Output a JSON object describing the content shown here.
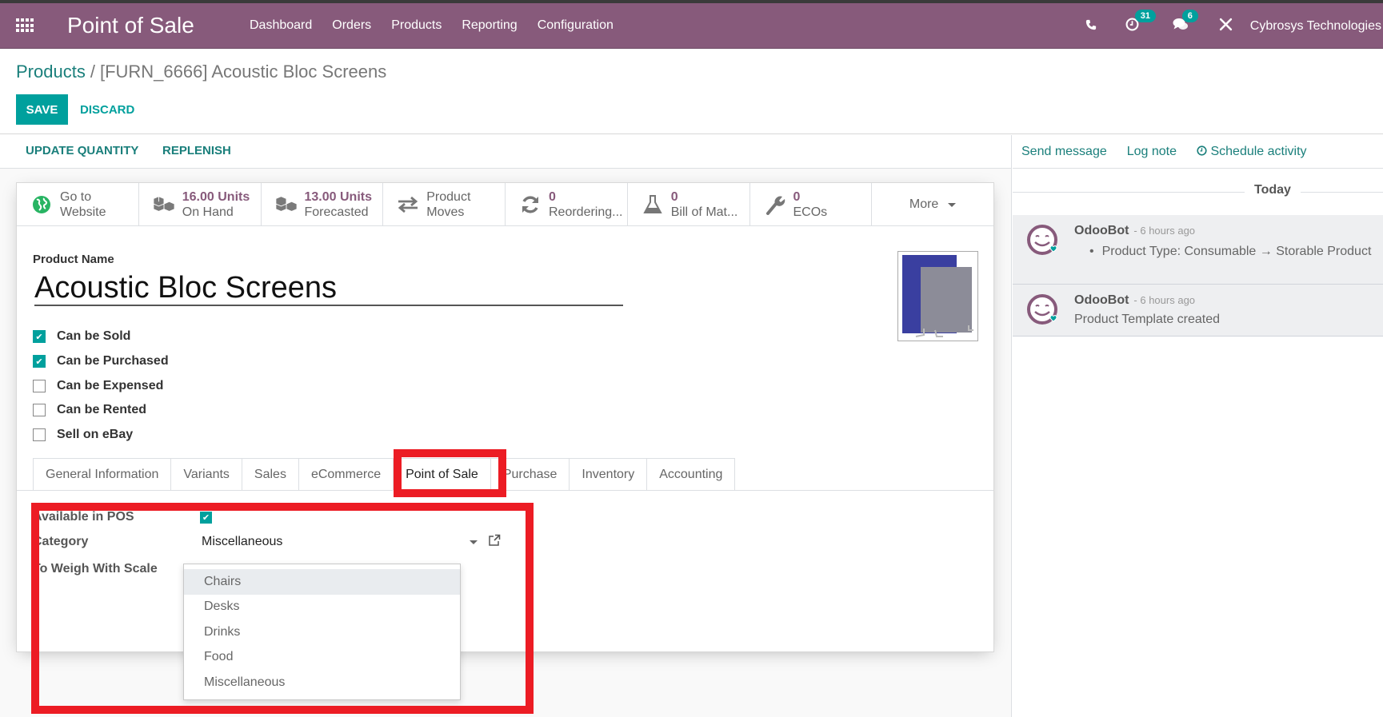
{
  "navbar": {
    "app_title": "Point of Sale",
    "menu": [
      "Dashboard",
      "Orders",
      "Products",
      "Reporting",
      "Configuration"
    ],
    "activity_count": "31",
    "message_count": "6",
    "company": "Cybrosys Technologies",
    "brand_color": "#875a7b"
  },
  "breadcrumb": {
    "parent": "Products",
    "separator": "/",
    "current": "[FURN_6666] Acoustic Bloc Screens"
  },
  "actions": {
    "save": "SAVE",
    "discard": "DISCARD"
  },
  "statusbar": {
    "update_quantity": "UPDATE QUANTITY",
    "replenish": "REPLENISH"
  },
  "smart_buttons": [
    {
      "icon": "globe-icon",
      "value": "Go to",
      "label": "Website"
    },
    {
      "icon": "cubes-icon",
      "value": "16.00 Units",
      "label": "On Hand"
    },
    {
      "icon": "cubes-icon",
      "value": "13.00 Units",
      "label": "Forecasted"
    },
    {
      "icon": "exchange-icon",
      "value": "Product",
      "label": "Moves"
    },
    {
      "icon": "refresh-icon",
      "value": "0",
      "label": "Reordering..."
    },
    {
      "icon": "flask-icon",
      "value": "0",
      "label": "Bill of Mat..."
    },
    {
      "icon": "wrench-icon",
      "value": "0",
      "label": "ECOs"
    }
  ],
  "more_label": "More",
  "product": {
    "name_label": "Product Name",
    "name": "Acoustic Bloc Screens",
    "flags": [
      {
        "label": "Can be Sold",
        "checked": true
      },
      {
        "label": "Can be Purchased",
        "checked": true
      },
      {
        "label": "Can be Expensed",
        "checked": false
      },
      {
        "label": "Can be Rented",
        "checked": false
      },
      {
        "label": "Sell on eBay",
        "checked": false
      }
    ]
  },
  "tabs": [
    "General Information",
    "Variants",
    "Sales",
    "eCommerce",
    "Point of Sale",
    "Purchase",
    "Inventory",
    "Accounting"
  ],
  "active_tab": "Point of Sale",
  "pos": {
    "available_label": "Available in POS",
    "available_checked": true,
    "category_label": "Category",
    "category_value": "Miscellaneous",
    "weigh_label": "To Weigh With Scale",
    "weigh_checked": false,
    "category_options": [
      "Chairs",
      "Desks",
      "Drinks",
      "Food",
      "Miscellaneous"
    ],
    "highlighted_option": "Chairs"
  },
  "chatter": {
    "send_message": "Send message",
    "log_note": "Log note",
    "schedule_activity": "Schedule activity",
    "date_separator": "Today",
    "messages": [
      {
        "author": "OdooBot",
        "time": "- 6 hours ago",
        "body": "Product Type: Consumable → Storable Product",
        "bullet": true
      },
      {
        "author": "OdooBot",
        "time": "- 6 hours ago",
        "body": "Product Template created",
        "bullet": false
      }
    ]
  },
  "colors": {
    "primary": "#00a09d",
    "link": "#1a7f7b",
    "annotation": "#ec1c24"
  }
}
